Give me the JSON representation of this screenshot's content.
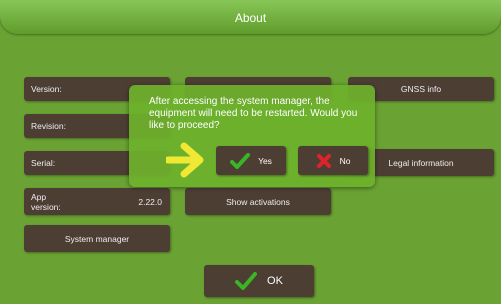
{
  "window": {
    "title": "About"
  },
  "info": {
    "version_label": "Version:",
    "revision_label": "Revision:",
    "serial_label": "Serial:",
    "app_version_label": "App version:",
    "app_version_value": "2.22.0"
  },
  "buttons": {
    "gnss_info": "GNSS info",
    "legal_information": "Legal information",
    "show_activations": "Show activations",
    "system_manager": "System manager",
    "ok": "OK"
  },
  "dialog": {
    "message": "After accessing the system manager, the equipment will need to be restarted. Would you like to proceed?",
    "yes": "Yes",
    "no": "No"
  },
  "colors": {
    "background": "#6aa233",
    "button": "#4d3e34",
    "check": "#3ab526",
    "cross": "#e0232a",
    "arrow": "#f0e832"
  },
  "icons": [
    "check-icon",
    "cross-icon",
    "pointer-arrow-icon"
  ]
}
